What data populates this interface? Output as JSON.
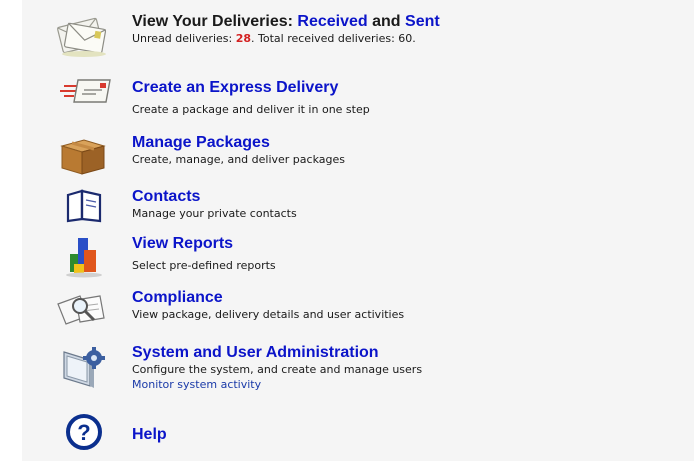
{
  "deliveries": {
    "title_prefix": "View Your Deliveries: ",
    "received_link": "Received",
    "and_text": " and ",
    "sent_link": "Sent",
    "unread_label": "Unread deliveries: ",
    "unread_count": "28",
    "total_label": ". Total received deliveries: 60.",
    "icon": "envelopes-icon"
  },
  "express": {
    "title": "Create an Express Delivery",
    "description": "Create a package and deliver it in one step",
    "icon": "express-envelope-icon"
  },
  "packages": {
    "title": "Manage Packages",
    "description": "Create, manage, and deliver packages",
    "icon": "package-box-icon"
  },
  "contacts": {
    "title": "Contacts",
    "description": "Manage your private contacts",
    "icon": "address-book-icon"
  },
  "reports": {
    "title": "View Reports",
    "description": "Select pre-defined reports",
    "icon": "bar-chart-icon"
  },
  "compliance": {
    "title": "Compliance",
    "description": "View package, delivery details and user activities",
    "icon": "magnifier-documents-icon"
  },
  "admin": {
    "title": "System and User Administration",
    "description": "Configure the system, and create and manage users",
    "monitor_link": "Monitor system activity",
    "icon": "monitor-gear-icon"
  },
  "help": {
    "title": "Help",
    "icon": "help-question-icon"
  },
  "colors": {
    "link_blue": "#0b14c9",
    "unread_red": "#d42222",
    "panel_bg": "#f5f5f5"
  }
}
